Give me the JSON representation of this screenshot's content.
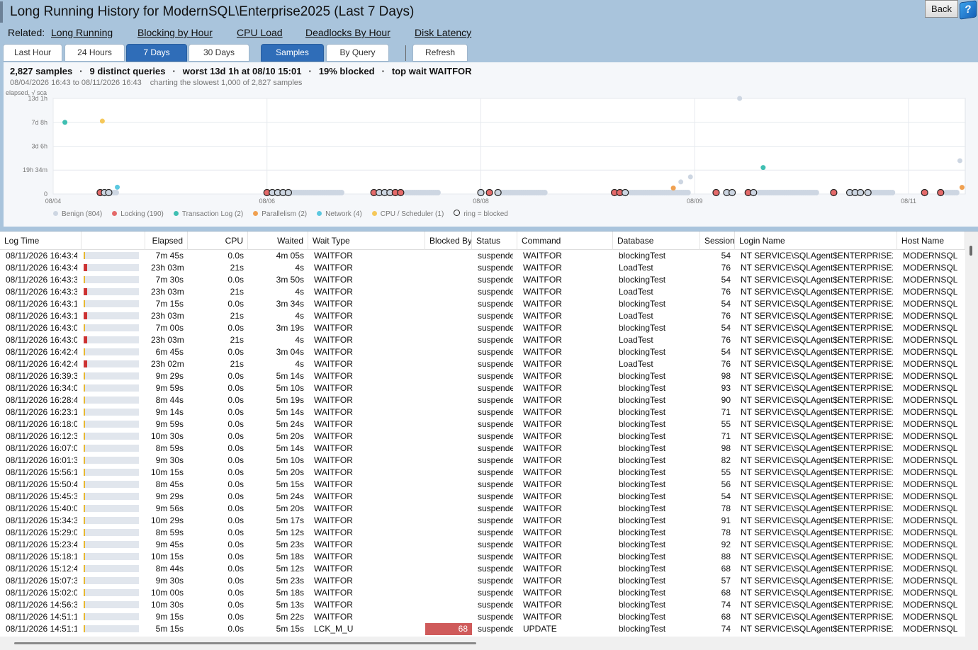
{
  "header": {
    "title": "Long Running History for ModernSQL\\Enterprise2025 (Last 7 Days)",
    "related_label": "Related:",
    "related_links": [
      "Long Running",
      "Blocking by Hour",
      "CPU Load",
      "Deadlocks By Hour",
      "Disk Latency"
    ],
    "back_label": "Back",
    "help_label": "?"
  },
  "tabs": {
    "range": [
      {
        "label": "Last Hour",
        "active": false
      },
      {
        "label": "24 Hours",
        "active": false
      },
      {
        "label": "7 Days",
        "active": true
      },
      {
        "label": "30 Days",
        "active": false
      }
    ],
    "view": [
      {
        "label": "Samples",
        "active": true
      },
      {
        "label": "By Query",
        "active": false
      }
    ],
    "refresh_label": "Refresh"
  },
  "summary": {
    "samples": "2,827 samples",
    "distinct": "9 distinct queries",
    "worst": "worst 13d 1h at 08/10 15:01",
    "blocked": "19% blocked",
    "top_wait": "top wait WAITFOR",
    "range": "08/04/2026 16:43 to 08/11/2026 16:43",
    "charting": "charting the slowest 1,000 of 2,827 samples"
  },
  "chart_data": {
    "type": "scatter",
    "ylabel": "elapsed, √ sca",
    "y_scale": "sqrt",
    "y_ticks": [
      "0",
      "19h 34m",
      "3d 6h",
      "7d 8h",
      "13d 1h"
    ],
    "y_tick_values_hours": [
      0,
      19.57,
      78,
      176,
      313
    ],
    "x_ticks": [
      "08/04",
      "08/06",
      "08/08",
      "08/09",
      "08/11"
    ],
    "x_tick_positions_days": [
      0,
      2,
      4,
      6,
      8
    ],
    "x_range_days": [
      0,
      8.53
    ],
    "y_range_hours": [
      0,
      313
    ],
    "grid": true,
    "legend": [
      {
        "name": "Benign (804)",
        "color": "#cdd6e2"
      },
      {
        "name": "Locking (190)",
        "color": "#e46a6a"
      },
      {
        "name": "Transaction Log (2)",
        "color": "#3fbfb2"
      },
      {
        "name": "Parallelism (2)",
        "color": "#f0a050"
      },
      {
        "name": "Network (4)",
        "color": "#5cc8e0"
      },
      {
        "name": "CPU / Scheduler (1)",
        "color": "#f5c85a"
      },
      {
        "name": "ring = blocked",
        "color": "ring"
      }
    ],
    "legend_position": "bottom-left",
    "points": [
      {
        "x": 0.11,
        "y": 176,
        "cat": "Transaction Log"
      },
      {
        "x": 0.46,
        "y": 182,
        "cat": "CPU / Scheduler"
      },
      {
        "x": 6.42,
        "y": 313,
        "cat": "Benign"
      },
      {
        "x": 6.64,
        "y": 24,
        "cat": "Transaction Log"
      },
      {
        "x": 8.48,
        "y": 38,
        "cat": "Benign"
      },
      {
        "x": 5.96,
        "y": 10,
        "cat": "Benign"
      },
      {
        "x": 5.87,
        "y": 5,
        "cat": "Benign"
      },
      {
        "x": 5.8,
        "y": 1.2,
        "cat": "Parallelism"
      },
      {
        "x": 8.5,
        "y": 1.5,
        "cat": "Parallelism"
      },
      {
        "x": 0.6,
        "y": 1.6,
        "cat": "Network"
      },
      {
        "x": 0.44,
        "y": 0,
        "cat": "Locking",
        "blocked": true
      },
      {
        "x": 0.48,
        "y": 0,
        "cat": "Benign",
        "blocked": true
      },
      {
        "x": 0.52,
        "y": 0,
        "cat": "Benign",
        "blocked": true
      },
      {
        "x": 2.0,
        "y": 0,
        "cat": "Locking",
        "blocked": true
      },
      {
        "x": 2.05,
        "y": 0,
        "cat": "Benign",
        "blocked": true
      },
      {
        "x": 2.1,
        "y": 0,
        "cat": "Benign",
        "blocked": true
      },
      {
        "x": 2.15,
        "y": 0,
        "cat": "Benign",
        "blocked": true
      },
      {
        "x": 2.2,
        "y": 0,
        "cat": "Benign",
        "blocked": true
      },
      {
        "x": 3.0,
        "y": 0,
        "cat": "Locking",
        "blocked": true
      },
      {
        "x": 3.05,
        "y": 0,
        "cat": "Benign",
        "blocked": true
      },
      {
        "x": 3.1,
        "y": 0,
        "cat": "Benign",
        "blocked": true
      },
      {
        "x": 3.15,
        "y": 0,
        "cat": "Benign",
        "blocked": true
      },
      {
        "x": 3.2,
        "y": 0,
        "cat": "Locking",
        "blocked": true
      },
      {
        "x": 3.25,
        "y": 0,
        "cat": "Locking",
        "blocked": true
      },
      {
        "x": 4.0,
        "y": 0,
        "cat": "Benign",
        "blocked": true
      },
      {
        "x": 4.08,
        "y": 0,
        "cat": "Locking",
        "blocked": true
      },
      {
        "x": 4.16,
        "y": 0,
        "cat": "Benign",
        "blocked": true
      },
      {
        "x": 5.25,
        "y": 0,
        "cat": "Locking",
        "blocked": true
      },
      {
        "x": 5.3,
        "y": 0,
        "cat": "Locking",
        "blocked": true
      },
      {
        "x": 5.35,
        "y": 0,
        "cat": "Benign",
        "blocked": true
      },
      {
        "x": 6.2,
        "y": 0,
        "cat": "Locking",
        "blocked": true
      },
      {
        "x": 6.3,
        "y": 0,
        "cat": "Benign",
        "blocked": true
      },
      {
        "x": 6.35,
        "y": 0,
        "cat": "Benign",
        "blocked": true
      },
      {
        "x": 6.5,
        "y": 0,
        "cat": "Locking",
        "blocked": true
      },
      {
        "x": 6.55,
        "y": 0,
        "cat": "Benign",
        "blocked": true
      },
      {
        "x": 7.3,
        "y": 0,
        "cat": "Locking",
        "blocked": true
      },
      {
        "x": 7.45,
        "y": 0,
        "cat": "Benign",
        "blocked": true
      },
      {
        "x": 7.5,
        "y": 0,
        "cat": "Benign",
        "blocked": true
      },
      {
        "x": 7.55,
        "y": 0,
        "cat": "Benign",
        "blocked": true
      },
      {
        "x": 7.62,
        "y": 0,
        "cat": "Benign",
        "blocked": true
      },
      {
        "x": 8.15,
        "y": 0,
        "cat": "Locking",
        "blocked": true
      },
      {
        "x": 8.3,
        "y": 0,
        "cat": "Locking",
        "blocked": true
      }
    ],
    "benign_clusters": [
      {
        "x_start": 0.55,
        "x_end": 0.6
      },
      {
        "x_start": 2.2,
        "x_end": 2.7
      },
      {
        "x_start": 3.3,
        "x_end": 3.6
      },
      {
        "x_start": 4.2,
        "x_end": 4.6
      },
      {
        "x_start": 5.4,
        "x_end": 5.95
      },
      {
        "x_start": 6.6,
        "x_end": 7.15
      },
      {
        "x_start": 7.65,
        "x_end": 7.85
      },
      {
        "x_start": 8.35,
        "x_end": 8.45
      }
    ]
  },
  "grid": {
    "columns": [
      "Log Time",
      "",
      "Elapsed",
      "CPU",
      "Waited",
      "Wait Type",
      "Blocked By",
      "Status",
      "Command",
      "Database",
      "Session",
      "Login Name",
      "Host Name"
    ],
    "bar_colors": {
      "yellow": "#e8b830",
      "red": "#cc3333"
    },
    "rows": [
      [
        "08/11/2026 16:43:46",
        0.01,
        "y",
        "7m 45s",
        "0.0s",
        "4m 05s",
        "WAITFOR",
        "",
        "suspended",
        "WAITFOR",
        "blockingTest",
        "54",
        "NT SERVICE\\SQLAgent$ENTERPRISE2025",
        "MODERNSQL"
      ],
      [
        "08/11/2026 16:43:46",
        0.07,
        "r",
        "23h 03m",
        "21s",
        "4s",
        "WAITFOR",
        "",
        "suspended",
        "WAITFOR",
        "LoadTest",
        "76",
        "NT SERVICE\\SQLAgent$ENTERPRISE2025",
        "MODERNSQL"
      ],
      [
        "08/11/2026 16:43:30",
        0.01,
        "y",
        "7m 30s",
        "0.0s",
        "3m 50s",
        "WAITFOR",
        "",
        "suspended",
        "WAITFOR",
        "blockingTest",
        "54",
        "NT SERVICE\\SQLAgent$ENTERPRISE2025",
        "MODERNSQL"
      ],
      [
        "08/11/2026 16:43:30",
        0.07,
        "r",
        "23h 03m",
        "21s",
        "4s",
        "WAITFOR",
        "",
        "suspended",
        "WAITFOR",
        "LoadTest",
        "76",
        "NT SERVICE\\SQLAgent$ENTERPRISE2025",
        "MODERNSQL"
      ],
      [
        "08/11/2026 16:43:15",
        0.01,
        "y",
        "7m 15s",
        "0.0s",
        "3m 34s",
        "WAITFOR",
        "",
        "suspended",
        "WAITFOR",
        "blockingTest",
        "54",
        "NT SERVICE\\SQLAgent$ENTERPRISE2025",
        "MODERNSQL"
      ],
      [
        "08/11/2026 16:43:15",
        0.07,
        "r",
        "23h 03m",
        "21s",
        "4s",
        "WAITFOR",
        "",
        "suspended",
        "WAITFOR",
        "LoadTest",
        "76",
        "NT SERVICE\\SQLAgent$ENTERPRISE2025",
        "MODERNSQL"
      ],
      [
        "08/11/2026 16:43:00",
        0.01,
        "y",
        "7m 00s",
        "0.0s",
        "3m 19s",
        "WAITFOR",
        "",
        "suspended",
        "WAITFOR",
        "blockingTest",
        "54",
        "NT SERVICE\\SQLAgent$ENTERPRISE2025",
        "MODERNSQL"
      ],
      [
        "08/11/2026 16:43:00",
        0.07,
        "r",
        "23h 03m",
        "21s",
        "4s",
        "WAITFOR",
        "",
        "suspended",
        "WAITFOR",
        "LoadTest",
        "76",
        "NT SERVICE\\SQLAgent$ENTERPRISE2025",
        "MODERNSQL"
      ],
      [
        "08/11/2026 16:42:45",
        0.01,
        "y",
        "6m 45s",
        "0.0s",
        "3m 04s",
        "WAITFOR",
        "",
        "suspended",
        "WAITFOR",
        "blockingTest",
        "54",
        "NT SERVICE\\SQLAgent$ENTERPRISE2025",
        "MODERNSQL"
      ],
      [
        "08/11/2026 16:42:45",
        0.07,
        "r",
        "23h 02m",
        "21s",
        "4s",
        "WAITFOR",
        "",
        "suspended",
        "WAITFOR",
        "LoadTest",
        "76",
        "NT SERVICE\\SQLAgent$ENTERPRISE2025",
        "MODERNSQL"
      ],
      [
        "08/11/2026 16:39:30",
        0.01,
        "y",
        "9m 29s",
        "0.0s",
        "5m 14s",
        "WAITFOR",
        "",
        "suspended",
        "WAITFOR",
        "blockingTest",
        "98",
        "NT SERVICE\\SQLAgent$ENTERPRISE2025",
        "MODERNSQL"
      ],
      [
        "08/11/2026 16:34:00",
        0.01,
        "y",
        "9m 59s",
        "0.0s",
        "5m 10s",
        "WAITFOR",
        "",
        "suspended",
        "WAITFOR",
        "blockingTest",
        "93",
        "NT SERVICE\\SQLAgent$ENTERPRISE2025",
        "MODERNSQL"
      ],
      [
        "08/11/2026 16:28:45",
        0.01,
        "y",
        "8m 44s",
        "0.0s",
        "5m 19s",
        "WAITFOR",
        "",
        "suspended",
        "WAITFOR",
        "blockingTest",
        "90",
        "NT SERVICE\\SQLAgent$ENTERPRISE2025",
        "MODERNSQL"
      ],
      [
        "08/11/2026 16:23:15",
        0.01,
        "y",
        "9m 14s",
        "0.0s",
        "5m 14s",
        "WAITFOR",
        "",
        "suspended",
        "WAITFOR",
        "blockingTest",
        "71",
        "NT SERVICE\\SQLAgent$ENTERPRISE2025",
        "MODERNSQL"
      ],
      [
        "08/11/2026 16:18:00",
        0.01,
        "y",
        "9m 59s",
        "0.0s",
        "5m 24s",
        "WAITFOR",
        "",
        "suspended",
        "WAITFOR",
        "blockingTest",
        "55",
        "NT SERVICE\\SQLAgent$ENTERPRISE2025",
        "MODERNSQL"
      ],
      [
        "08/11/2026 16:12:30",
        0.01,
        "y",
        "10m 30s",
        "0.0s",
        "5m 20s",
        "WAITFOR",
        "",
        "suspended",
        "WAITFOR",
        "blockingTest",
        "71",
        "NT SERVICE\\SQLAgent$ENTERPRISE2025",
        "MODERNSQL"
      ],
      [
        "08/11/2026 16:07:00",
        0.01,
        "y",
        "8m 59s",
        "0.0s",
        "5m 14s",
        "WAITFOR",
        "",
        "suspended",
        "WAITFOR",
        "blockingTest",
        "98",
        "NT SERVICE\\SQLAgent$ENTERPRISE2025",
        "MODERNSQL"
      ],
      [
        "08/11/2026 16:01:30",
        0.01,
        "y",
        "9m 30s",
        "0.0s",
        "5m 10s",
        "WAITFOR",
        "",
        "suspended",
        "WAITFOR",
        "blockingTest",
        "82",
        "NT SERVICE\\SQLAgent$ENTERPRISE2025",
        "MODERNSQL"
      ],
      [
        "08/11/2026 15:56:15",
        0.01,
        "y",
        "10m 15s",
        "0.0s",
        "5m 20s",
        "WAITFOR",
        "",
        "suspended",
        "WAITFOR",
        "blockingTest",
        "55",
        "NT SERVICE\\SQLAgent$ENTERPRISE2025",
        "MODERNSQL"
      ],
      [
        "08/11/2026 15:50:46",
        0.01,
        "y",
        "8m 45s",
        "0.0s",
        "5m 15s",
        "WAITFOR",
        "",
        "suspended",
        "WAITFOR",
        "blockingTest",
        "56",
        "NT SERVICE\\SQLAgent$ENTERPRISE2025",
        "MODERNSQL"
      ],
      [
        "08/11/2026 15:45:30",
        0.01,
        "y",
        "9m 29s",
        "0.0s",
        "5m 24s",
        "WAITFOR",
        "",
        "suspended",
        "WAITFOR",
        "blockingTest",
        "54",
        "NT SERVICE\\SQLAgent$ENTERPRISE2025",
        "MODERNSQL"
      ],
      [
        "08/11/2026 15:40:00",
        0.01,
        "y",
        "9m 56s",
        "0.0s",
        "5m 20s",
        "WAITFOR",
        "",
        "suspended",
        "WAITFOR",
        "blockingTest",
        "78",
        "NT SERVICE\\SQLAgent$ENTERPRISE2025",
        "MODERNSQL"
      ],
      [
        "08/11/2026 15:34:30",
        0.01,
        "y",
        "10m 29s",
        "0.0s",
        "5m 17s",
        "WAITFOR",
        "",
        "suspended",
        "WAITFOR",
        "blockingTest",
        "91",
        "NT SERVICE\\SQLAgent$ENTERPRISE2025",
        "MODERNSQL"
      ],
      [
        "08/11/2026 15:29:00",
        0.01,
        "y",
        "8m 59s",
        "0.0s",
        "5m 12s",
        "WAITFOR",
        "",
        "suspended",
        "WAITFOR",
        "blockingTest",
        "78",
        "NT SERVICE\\SQLAgent$ENTERPRISE2025",
        "MODERNSQL"
      ],
      [
        "08/11/2026 15:23:45",
        0.01,
        "y",
        "9m 45s",
        "0.0s",
        "5m 23s",
        "WAITFOR",
        "",
        "suspended",
        "WAITFOR",
        "blockingTest",
        "92",
        "NT SERVICE\\SQLAgent$ENTERPRISE2025",
        "MODERNSQL"
      ],
      [
        "08/11/2026 15:18:15",
        0.01,
        "y",
        "10m 15s",
        "0.0s",
        "5m 18s",
        "WAITFOR",
        "",
        "suspended",
        "WAITFOR",
        "blockingTest",
        "88",
        "NT SERVICE\\SQLAgent$ENTERPRISE2025",
        "MODERNSQL"
      ],
      [
        "08/11/2026 15:12:45",
        0.01,
        "y",
        "8m 44s",
        "0.0s",
        "5m 12s",
        "WAITFOR",
        "",
        "suspended",
        "WAITFOR",
        "blockingTest",
        "68",
        "NT SERVICE\\SQLAgent$ENTERPRISE2025",
        "MODERNSQL"
      ],
      [
        "08/11/2026 15:07:31",
        0.01,
        "y",
        "9m 30s",
        "0.0s",
        "5m 23s",
        "WAITFOR",
        "",
        "suspended",
        "WAITFOR",
        "blockingTest",
        "57",
        "NT SERVICE\\SQLAgent$ENTERPRISE2025",
        "MODERNSQL"
      ],
      [
        "08/11/2026 15:02:01",
        0.01,
        "y",
        "10m 00s",
        "0.0s",
        "5m 18s",
        "WAITFOR",
        "",
        "suspended",
        "WAITFOR",
        "blockingTest",
        "68",
        "NT SERVICE\\SQLAgent$ENTERPRISE2025",
        "MODERNSQL"
      ],
      [
        "08/11/2026 14:56:30",
        0.01,
        "y",
        "10m 30s",
        "0.0s",
        "5m 13s",
        "WAITFOR",
        "",
        "suspended",
        "WAITFOR",
        "blockingTest",
        "74",
        "NT SERVICE\\SQLAgent$ENTERPRISE2025",
        "MODERNSQL"
      ],
      [
        "08/11/2026 14:51:15",
        0.01,
        "y",
        "9m 15s",
        "0.0s",
        "5m 22s",
        "WAITFOR",
        "",
        "suspended",
        "WAITFOR",
        "blockingTest",
        "68",
        "NT SERVICE\\SQLAgent$ENTERPRISE2025",
        "MODERNSQL"
      ],
      [
        "08/11/2026 14:51:15",
        0.01,
        "y",
        "5m 15s",
        "0.0s",
        "5m 15s",
        "LCK_M_U",
        "68",
        "suspended",
        "UPDATE",
        "blockingTest",
        "74",
        "NT SERVICE\\SQLAgent$ENTERPRISE2025",
        "MODERNSQL"
      ]
    ]
  }
}
